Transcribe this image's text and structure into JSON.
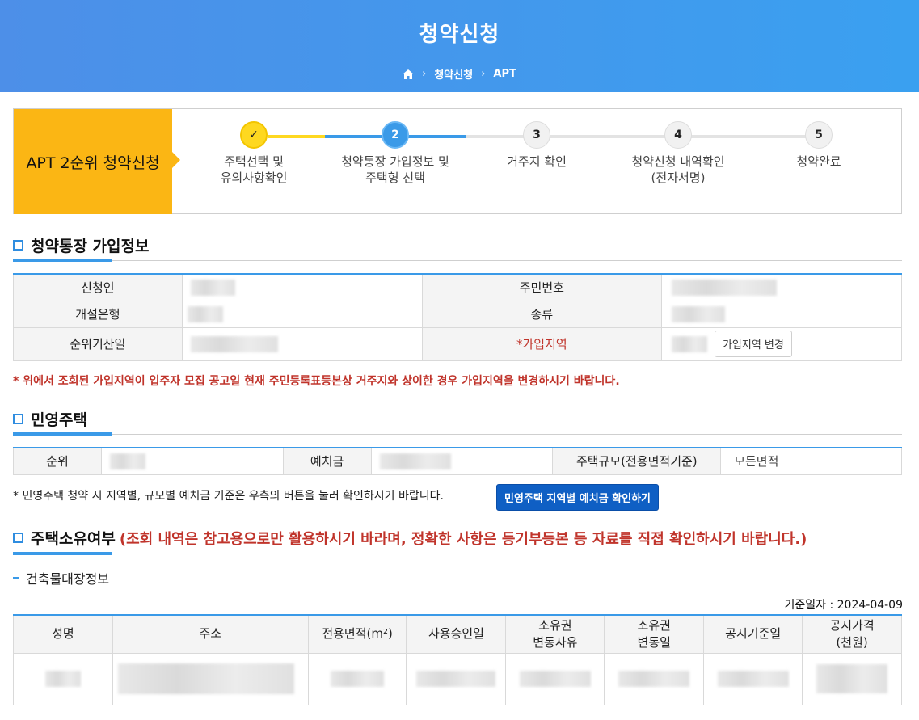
{
  "header": {
    "title": "청약신청",
    "breadcrumb": [
      "청약신청",
      "APT"
    ]
  },
  "steps": {
    "box_label": "APT 2순위 청약신청",
    "items": [
      {
        "num": "✓",
        "label1": "주택선택 및",
        "label2": "유의사항확인",
        "state": "done"
      },
      {
        "num": "2",
        "label1": "청약통장 가입정보 및",
        "label2": "주택형 선택",
        "state": "current"
      },
      {
        "num": "3",
        "label1": "거주지 확인",
        "label2": "",
        "state": "next"
      },
      {
        "num": "4",
        "label1": "청약신청 내역확인",
        "label2": "(전자서명)",
        "state": "next"
      },
      {
        "num": "5",
        "label1": "청약완료",
        "label2": "",
        "state": "next"
      }
    ]
  },
  "account": {
    "title": "청약통장 가입정보",
    "applicant_label": "신청인",
    "rrn_label": "주민번호",
    "bank_label": "개설은행",
    "type_label": "종류",
    "rank_date_label": "순위기산일",
    "region_req": "*",
    "region_label": "가입지역",
    "change_button": "가입지역 변경",
    "notice": "* 위에서 조회된 가입지역이 입주자 모집 공고일 현재 주민등록표등본상 거주지와 상이한 경우 가입지역을 변경하시기 바랍니다."
  },
  "private": {
    "title": "민영주택",
    "rank_label": "순위",
    "deposit_label": "예치금",
    "size_label": "주택규모(전용면적기준)",
    "size_value": "모든면적",
    "notice": "* 민영주택 청약 시 지역별, 규모별 예치금 기준은 우측의 버튼을 눌러 확인하시기 바랍니다.",
    "button": "민영주택 지역별 예치금 확인하기"
  },
  "ownership": {
    "title": "주택소유여부",
    "title_note": "(조회 내역은 참고용으로만 활용하시기 바라며, 정확한 사항은 등기부등본 등 자료를 직접 확인하시기 바랍니다.)",
    "subtitle": "건축물대장정보",
    "base_date": "기준일자 : 2024-04-09",
    "columns": [
      {
        "l1": "성명",
        "l2": ""
      },
      {
        "l1": "주소",
        "l2": ""
      },
      {
        "l1": "전용면적(m²)",
        "l2": ""
      },
      {
        "l1": "사용승인일",
        "l2": ""
      },
      {
        "l1": "소유권",
        "l2": "변동사유"
      },
      {
        "l1": "소유권",
        "l2": "변동일"
      },
      {
        "l1": "공시기준일",
        "l2": ""
      },
      {
        "l1": "공시가격",
        "l2": "(천원)"
      }
    ]
  },
  "colors": {
    "accent": "#3a9ae8",
    "step_box": "#fbb614",
    "done_circle": "#fed820",
    "red": "#c0342b",
    "button_blue": "#0f5fc4"
  }
}
